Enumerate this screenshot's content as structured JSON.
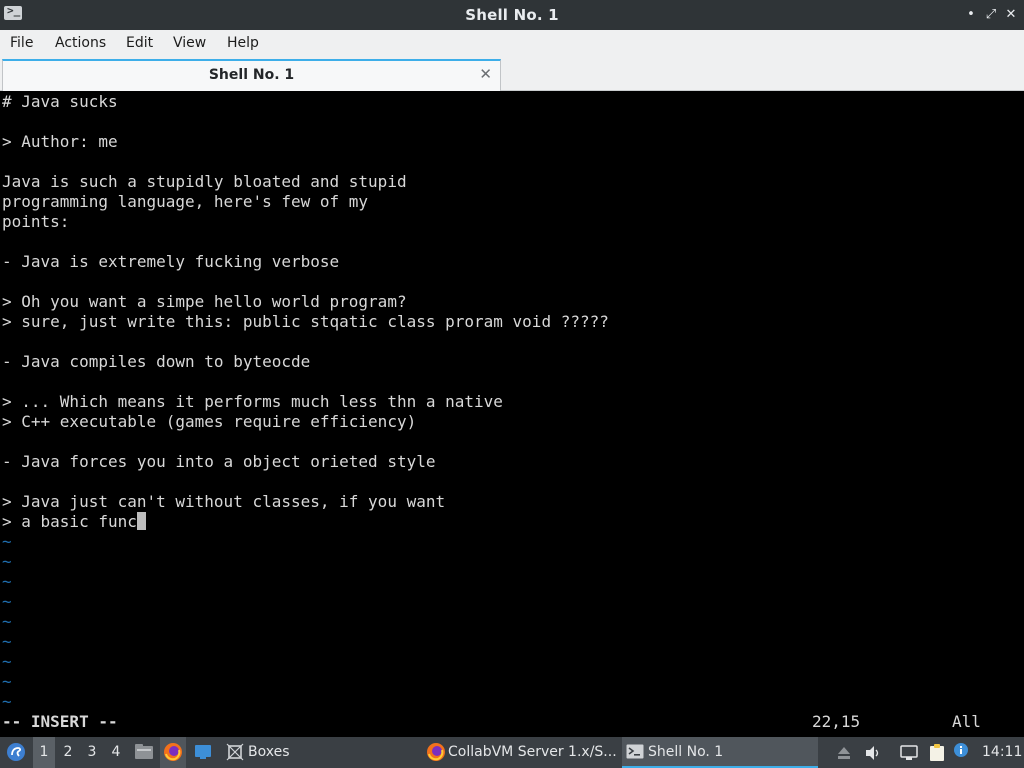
{
  "window": {
    "title": "Shell No. 1",
    "minimize_icon": "•",
    "maximize_icon": "⤢",
    "close_icon": "✕"
  },
  "menu": {
    "items": [
      "File",
      "Actions",
      "Edit",
      "View",
      "Help"
    ]
  },
  "tab": {
    "label": "Shell No. 1",
    "close_icon": "✕"
  },
  "terminal": {
    "lines": [
      "# Java sucks",
      "",
      "> Author: me",
      "",
      "Java is such a stupidly bloated and stupid",
      "programming language, here's few of my",
      "points:",
      "",
      "- Java is extremely fucking verbose",
      "",
      "> Oh you want a simpe hello world program?",
      "> sure, just write this: public stqatic class proram void ?????",
      "",
      "- Java compiles down to byteocde",
      "",
      "> ... Which means it performs much less thn a native",
      "> C++ executable (games require efficiency)",
      "",
      "- Java forces you into a object orieted style",
      "",
      "> Java just can't without classes, if you want",
      "> a basic func",
      "~",
      "~",
      "~",
      "~",
      "~",
      "~",
      "~",
      "~",
      "~"
    ],
    "mode": "-- INSERT --",
    "cursor_position": "22,15",
    "scroll_status": "All"
  },
  "taskbar": {
    "desktops": [
      "1",
      "2",
      "3",
      "4"
    ],
    "active_desktop": "1",
    "tasks": [
      {
        "label": "Boxes"
      },
      {
        "label": "CollabVM Server 1.x/S..."
      },
      {
        "label": "Shell No. 1"
      }
    ],
    "clock": "14:11"
  },
  "colors": {
    "titlebar": "#2f3437",
    "menubar": "#eff0f1",
    "terminal_bg": "#000000",
    "terminal_fg": "#d8d8d8",
    "tilde": "#1f6fb0",
    "taskbar": "#3a3f44",
    "accent": "#3daee9"
  }
}
